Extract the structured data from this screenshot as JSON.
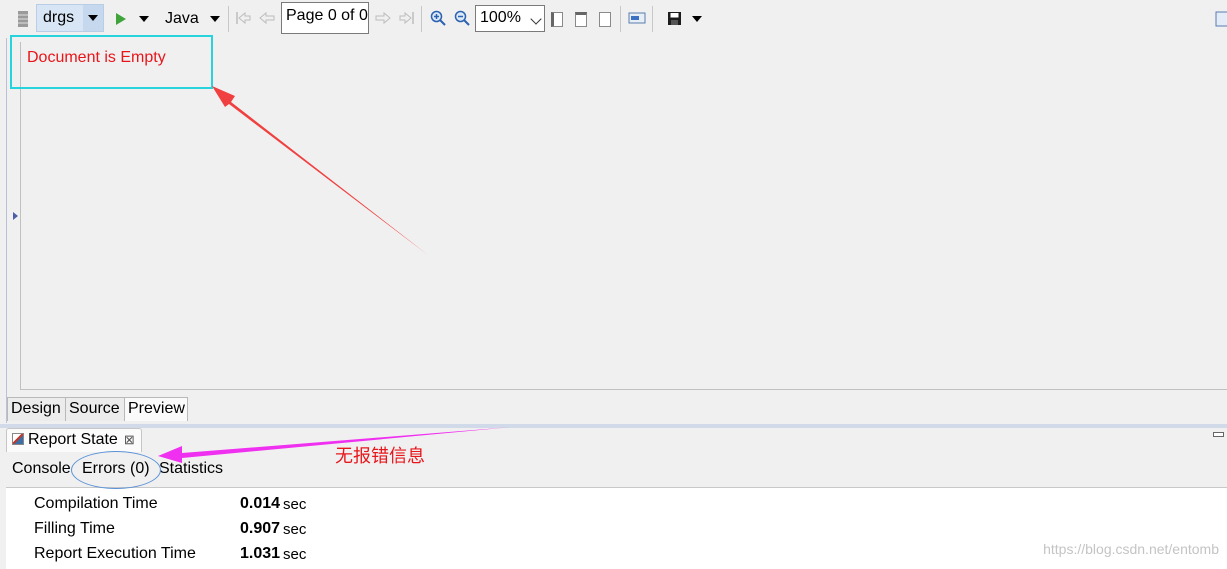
{
  "toolbar": {
    "datasource": "drgs",
    "language": "Java",
    "page_indicator": "Page 0 of 0",
    "zoom": "100%"
  },
  "preview": {
    "empty_message": "Document is Empty"
  },
  "editor_tabs": [
    "Design",
    "Source",
    "Preview"
  ],
  "report_panel": {
    "title": "Report State",
    "close_glyph": "⊠",
    "subtabs": [
      "Console",
      "Errors (0)",
      "Statistics"
    ],
    "stats": [
      {
        "label": "Compilation Time",
        "value": "0.014",
        "unit": "sec"
      },
      {
        "label": "Filling Time",
        "value": "0.907",
        "unit": "sec"
      },
      {
        "label": "Report Execution Time",
        "value": "1.031",
        "unit": "sec"
      }
    ]
  },
  "annotation_note": "无报错信息",
  "watermark": "https://blog.csdn.net/entomb",
  "colors": {
    "annotation_red": "#e8161b",
    "annotation_cyan": "#27d3dc",
    "annotation_magenta": "#f030f0",
    "annotation_blue": "#5b92d6"
  }
}
